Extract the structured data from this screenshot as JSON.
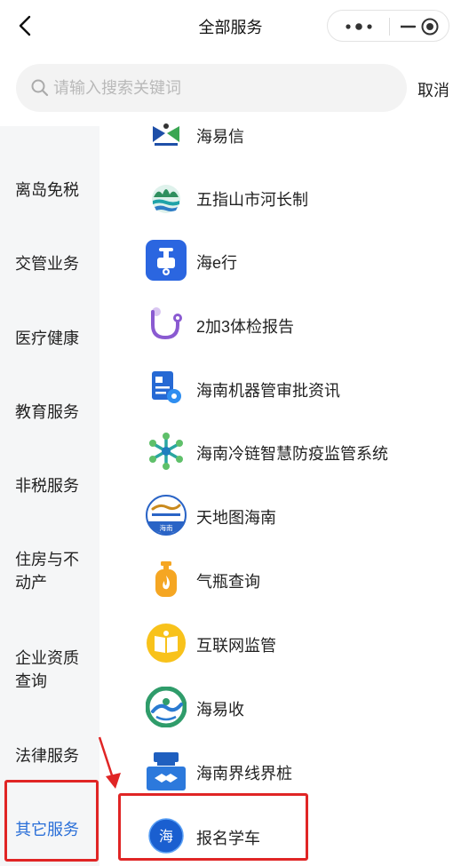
{
  "header": {
    "title": "全部服务",
    "back_icon": "chevron-left-icon",
    "more_icon": "more-dots-icon",
    "close_icon": "close-circle-icon"
  },
  "search": {
    "placeholder": "请输入搜索关键词",
    "value": "",
    "cancel_label": "取消"
  },
  "sidebar": {
    "items": [
      {
        "label": "离岛免税"
      },
      {
        "label": "交管业务"
      },
      {
        "label": "医疗健康"
      },
      {
        "label": "教育服务"
      },
      {
        "label": "非税服务"
      },
      {
        "label": "住房与不动产"
      },
      {
        "label": "企业资质查询"
      },
      {
        "label": "法律服务"
      },
      {
        "label": "其它服务",
        "selected": true
      }
    ]
  },
  "services": {
    "items": [
      {
        "label": "海易信",
        "icon": "hai-yi-xin-icon"
      },
      {
        "label": "五指山市河长制",
        "icon": "wuzhishan-river-chief-icon"
      },
      {
        "label": "海e行",
        "icon": "scooter-icon"
      },
      {
        "label": "2加3体检报告",
        "icon": "stethoscope-icon"
      },
      {
        "label": "海南机器管审批资讯",
        "icon": "document-gear-icon"
      },
      {
        "label": "海南冷链智慧防疫监管系统",
        "icon": "snowflake-icon"
      },
      {
        "label": "天地图海南",
        "icon": "tianditu-icon",
        "icon_text": "海南"
      },
      {
        "label": "气瓶查询",
        "icon": "gas-cylinder-icon"
      },
      {
        "label": "互联网监管",
        "icon": "open-book-icon"
      },
      {
        "label": "海易收",
        "icon": "hai-yi-shou-icon"
      },
      {
        "label": "海南界线界桩",
        "icon": "boundary-handshake-icon"
      },
      {
        "label": "报名学车",
        "icon": "learn-driving-icon",
        "icon_text": "海"
      }
    ]
  },
  "colors": {
    "highlight_red": "#e02525",
    "sidebar_bg": "#f5f6f7",
    "search_bg": "#f3f3f3",
    "accent_blue": "#2a6fd8"
  }
}
